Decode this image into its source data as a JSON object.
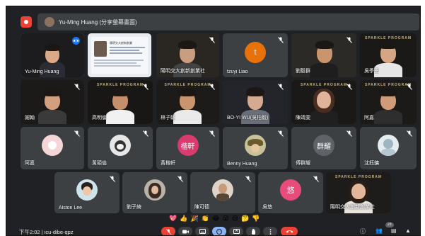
{
  "presenter": {
    "label": "Yu-Ming Huang (分享螢幕畫面)"
  },
  "tiles": [
    {
      "name": "Yu-Ming Huang",
      "kind": "self"
    },
    {
      "name": "",
      "kind": "slide",
      "slide_title": "陽明交大創新創業"
    },
    {
      "name": "陽明交大創新創業社",
      "kind": "video"
    },
    {
      "name": "tzuyi Liao",
      "kind": "letter",
      "letter": "t",
      "color": "#e8710a"
    },
    {
      "name": "劉毅群",
      "kind": "video"
    },
    {
      "name": "吳季恩",
      "kind": "video"
    },
    {
      "name": "謝翰",
      "kind": "video"
    },
    {
      "name": "高明倫",
      "kind": "video"
    },
    {
      "name": "林子驊",
      "kind": "video"
    },
    {
      "name": "BO-YI WU(吳柏毅)",
      "kind": "video"
    },
    {
      "name": "陳靖雯",
      "kind": "video"
    },
    {
      "name": "阿嘉",
      "kind": "video"
    },
    {
      "name": "阿嘉",
      "kind": "photo"
    },
    {
      "name": "黃碩倫",
      "kind": "photo"
    },
    {
      "name": "黃楷軒",
      "kind": "letter",
      "letter": "楷軒",
      "color": "#d93b6e"
    },
    {
      "name": "Benny Huang",
      "kind": "photo"
    },
    {
      "name": "傅群耀",
      "kind": "letter",
      "letter": "群耀",
      "color": "#5f6368"
    },
    {
      "name": "沈鈺鏞",
      "kind": "photo"
    },
    {
      "name": "Alston Lee",
      "kind": "photo"
    },
    {
      "name": "劉子綺",
      "kind": "photo"
    },
    {
      "name": "陳可德",
      "kind": "photo"
    },
    {
      "name": "吳悠",
      "kind": "letter",
      "letter": "悠",
      "color": "#e94b7a"
    },
    {
      "name": "陽明交大創新創業社",
      "kind": "video"
    }
  ],
  "banner_text": "SPARKLE PROGRAM",
  "reactions": [
    "💖",
    "👍",
    "🎉",
    "👏",
    "😂",
    "😮",
    "😢",
    "🤔",
    "👎"
  ],
  "bottom": {
    "time": "下午2:02",
    "separator": "|",
    "meeting_code": "icu-dibe-qpz",
    "participant_count": "23"
  },
  "icons": {
    "mic_off": "mic-off-icon",
    "camera": "camera-icon",
    "captions": "captions-icon",
    "emoji": "emoji-icon",
    "present": "present-icon",
    "raise_hand": "hand-icon",
    "more": "more-icon",
    "end_call": "end-call-icon"
  }
}
